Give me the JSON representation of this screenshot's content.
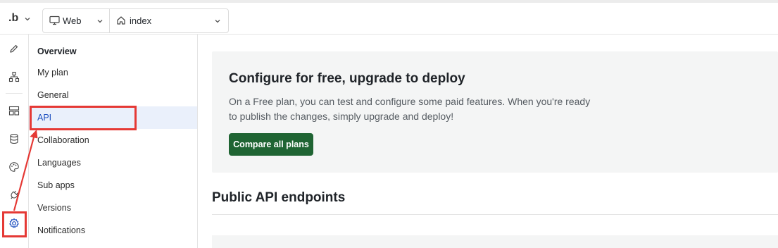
{
  "topbar": {
    "logo": ".b",
    "device_label": "Web",
    "page_label": "index"
  },
  "rail": {
    "icons": [
      "pencil-icon",
      "hierarchy-icon",
      "layout-icon",
      "database-icon",
      "palette-icon",
      "plug-icon",
      "gear-icon"
    ]
  },
  "settings_nav": {
    "items": [
      {
        "label": "Overview"
      },
      {
        "label": "My plan"
      },
      {
        "label": "General"
      },
      {
        "label": "API"
      },
      {
        "label": "Collaboration"
      },
      {
        "label": "Languages"
      },
      {
        "label": "Sub apps"
      },
      {
        "label": "Versions"
      },
      {
        "label": "Notifications"
      }
    ],
    "active": "API"
  },
  "main": {
    "upgrade_card": {
      "title": "Configure for free, upgrade to deploy",
      "body": "On a Free plan, you can test and configure some paid features. When you're ready to publish the changes, simply upgrade and deploy!",
      "button": "Compare all plans"
    },
    "section_title": "Public API endpoints"
  },
  "colors": {
    "accent_green": "#1f6433",
    "active_blue": "#1d4fbf",
    "annotation_red": "#e53935"
  }
}
